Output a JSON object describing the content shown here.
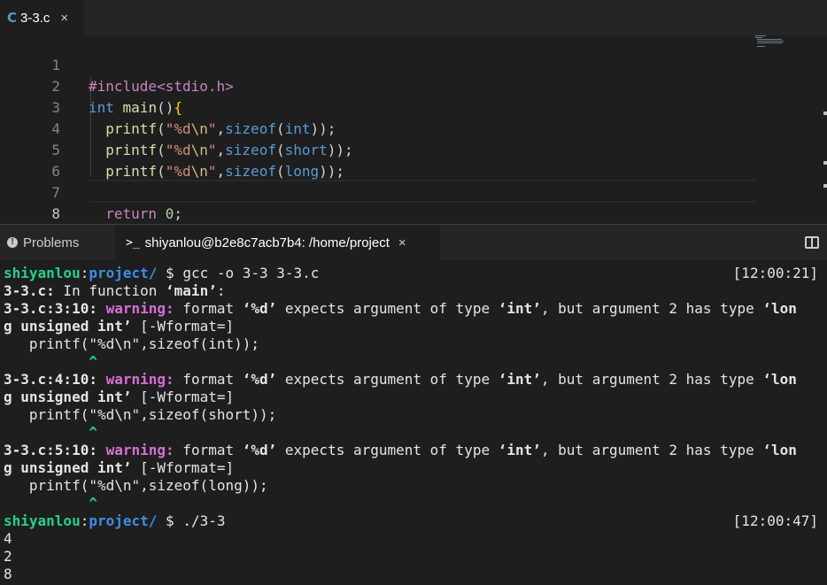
{
  "editor_tab": {
    "icon": "C",
    "label": "3-3.c",
    "close": "×"
  },
  "editor": {
    "lines": [
      {
        "num": "1",
        "text": "#include<stdio.h>"
      },
      {
        "num": "2",
        "text": "int main(){"
      },
      {
        "num": "3",
        "text": "  printf(\"%d\\n\",sizeof(int));"
      },
      {
        "num": "4",
        "text": "  printf(\"%d\\n\",sizeof(short));"
      },
      {
        "num": "5",
        "text": "  printf(\"%d\\n\",sizeof(long));"
      },
      {
        "num": "6",
        "text": ""
      },
      {
        "num": "7",
        "text": "  return 0;"
      },
      {
        "num": "8",
        "text": "}"
      }
    ]
  },
  "panel": {
    "problems_tab": "Problems",
    "problems_icon": "info-icon",
    "terminal_icon": ">_",
    "terminal_tab": "shiyanlou@b2e8c7acb7b4: /home/project",
    "terminal_close": "×",
    "split_icon": "split-editor-icon"
  },
  "terminal": {
    "prompt_user": "shiyanlou",
    "prompt_colon": ":",
    "prompt_path": "project/",
    "prompt_sign": " $ ",
    "cmd1": "gcc -o 3-3 3-3.c",
    "time1": "[12:00:21]",
    "infunc_file": "3-3.c:",
    "infunc_text": " In function ",
    "infunc_name": "‘main’",
    "infunc_end": ":",
    "warnings": [
      {
        "loc": "3-3.c:3:10:",
        "code": "   printf(\"%d\\n\",sizeof(int));"
      },
      {
        "loc": "3-3.c:4:10:",
        "code": "   printf(\"%d\\n\",sizeof(short));"
      },
      {
        "loc": "3-3.c:5:10:",
        "code": "   printf(\"%d\\n\",sizeof(long));"
      }
    ],
    "warn_word": "warning:",
    "warn_text1": " format ",
    "warn_fmt": "‘%d’",
    "warn_text2": " expects argument of type ",
    "warn_int": "‘int’",
    "warn_text3": ", but argument 2 has type ",
    "warn_lon": "‘lon",
    "warn_cont": "g unsigned int’",
    "warn_flag": " [-Wformat=]",
    "caret": "          ^",
    "cmd2": "./3-3",
    "time2": "[12:00:47]",
    "output": [
      "4",
      "2",
      "8"
    ]
  },
  "colors": {
    "green": "#23d18b",
    "blue": "#3b8eea",
    "magenta": "#d670d6"
  }
}
